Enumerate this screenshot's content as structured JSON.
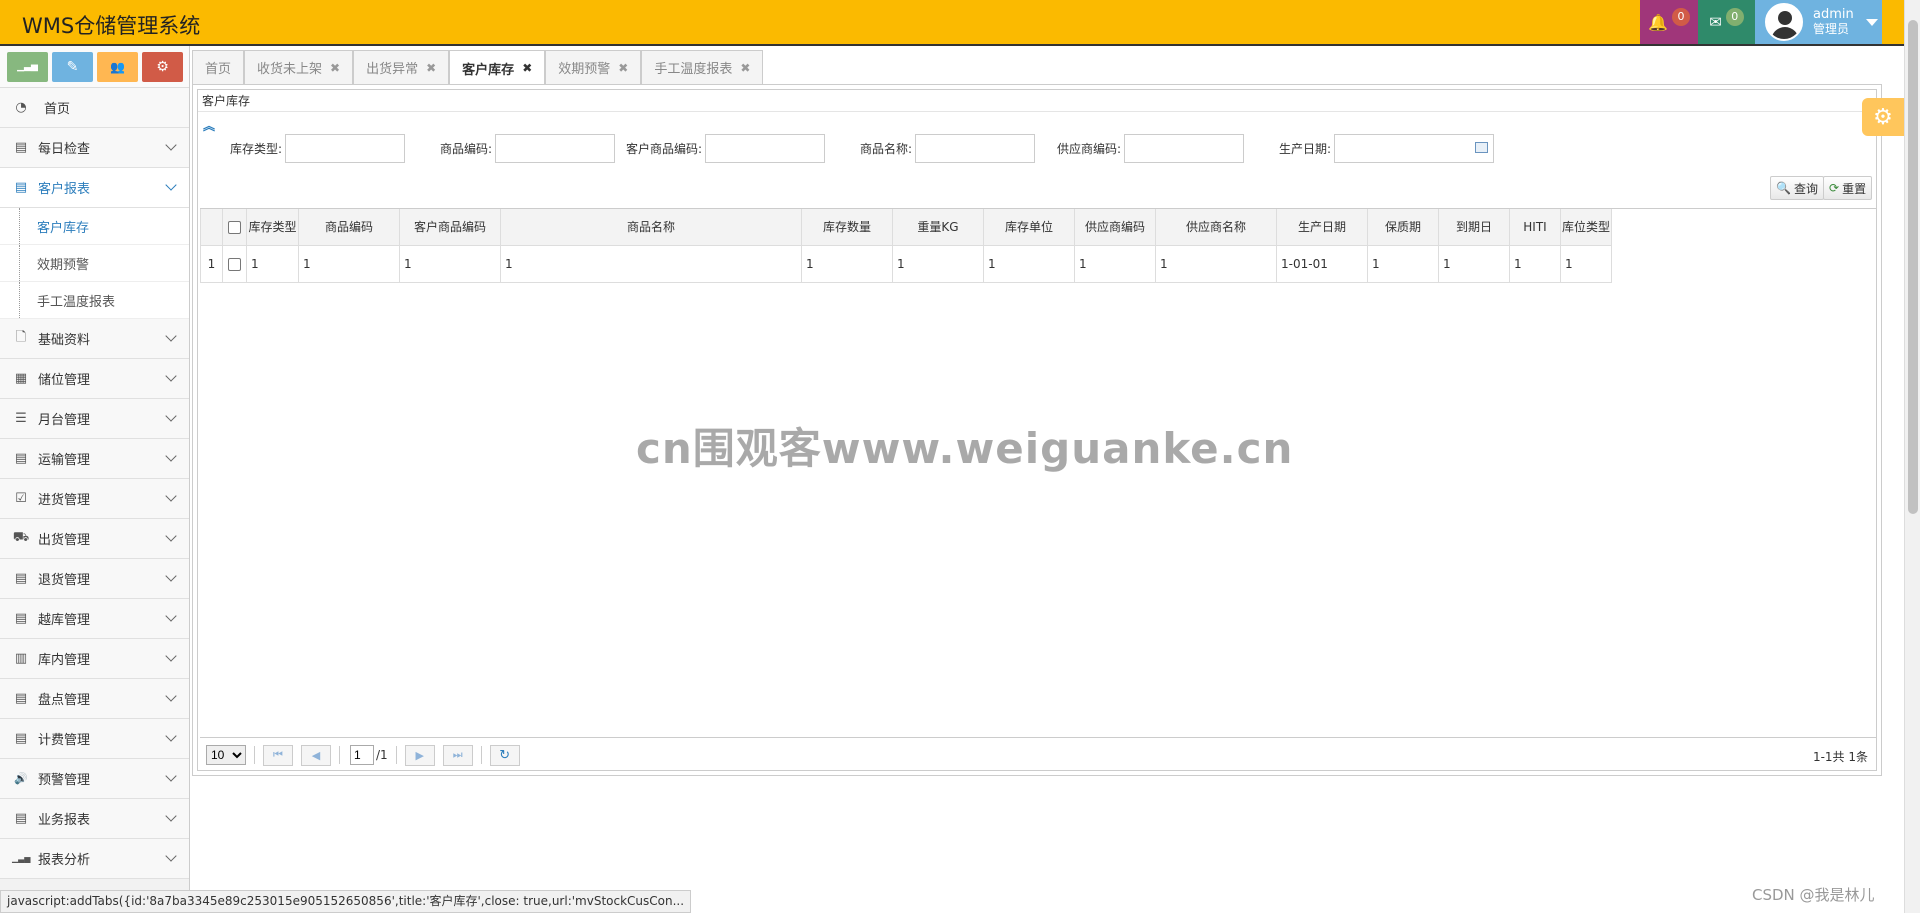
{
  "header": {
    "title": "WMS仓储管理系统",
    "notifications_count": "0",
    "messages_count": "0",
    "username": "admin",
    "role": "管理员",
    "colors": {
      "header_bg": "#fbba00",
      "bell_bg": "#a0367a",
      "mail_bg": "#2f8a6a",
      "user_bg": "#6fb3e0"
    }
  },
  "sidebar": {
    "shortcuts": [
      {
        "icon": "signal-icon",
        "glyph": "▁▃▅"
      },
      {
        "icon": "pencil-icon",
        "glyph": "✎"
      },
      {
        "icon": "group-icon",
        "glyph": "👥"
      },
      {
        "icon": "cogs-icon",
        "glyph": "⚙"
      }
    ],
    "items": [
      {
        "label": "首页",
        "icon": "dashboard-icon",
        "glyph": "◔",
        "expandable": false
      },
      {
        "label": "每日检查",
        "icon": "list-alt-icon",
        "glyph": "▤",
        "expandable": true
      },
      {
        "label": "客户报表",
        "icon": "list-alt-icon",
        "glyph": "▤",
        "expandable": true,
        "active": true
      },
      {
        "label": "基础资料",
        "icon": "file-icon",
        "glyph": "🗋",
        "expandable": true
      },
      {
        "label": "储位管理",
        "icon": "building-icon",
        "glyph": "▦",
        "expandable": true
      },
      {
        "label": "月台管理",
        "icon": "th-list-icon",
        "glyph": "☰",
        "expandable": true
      },
      {
        "label": "运输管理",
        "icon": "list-alt-icon",
        "glyph": "▤",
        "expandable": true
      },
      {
        "label": "进货管理",
        "icon": "check-square-icon",
        "glyph": "☑",
        "expandable": true
      },
      {
        "label": "出货管理",
        "icon": "truck-icon",
        "glyph": "⛟",
        "expandable": true
      },
      {
        "label": "退货管理",
        "icon": "list-alt-icon",
        "glyph": "▤",
        "expandable": true
      },
      {
        "label": "越库管理",
        "icon": "list-alt-icon",
        "glyph": "▤",
        "expandable": true
      },
      {
        "label": "库内管理",
        "icon": "film-icon",
        "glyph": "▥",
        "expandable": true
      },
      {
        "label": "盘点管理",
        "icon": "list-alt-icon",
        "glyph": "▤",
        "expandable": true
      },
      {
        "label": "计费管理",
        "icon": "list-alt-icon",
        "glyph": "▤",
        "expandable": true
      },
      {
        "label": "预警管理",
        "icon": "volume-icon",
        "glyph": "🔊",
        "expandable": true
      },
      {
        "label": "业务报表",
        "icon": "list-alt-icon",
        "glyph": "▤",
        "expandable": true
      },
      {
        "label": "报表分析",
        "icon": "signal-icon",
        "glyph": "▁▃▅",
        "expandable": true
      }
    ],
    "sub_items": [
      {
        "label": "客户库存",
        "active": true
      },
      {
        "label": "效期预警"
      },
      {
        "label": "手工温度报表"
      }
    ]
  },
  "tabs": [
    {
      "label": "首页",
      "closable": false
    },
    {
      "label": "收货未上架",
      "closable": true
    },
    {
      "label": "出货异常",
      "closable": true
    },
    {
      "label": "客户库存",
      "closable": true,
      "active": true
    },
    {
      "label": "效期预警",
      "closable": true
    },
    {
      "label": "手工温度报表",
      "closable": true
    }
  ],
  "panel": {
    "title": "客户库存",
    "collapse_glyph": "︽"
  },
  "search": {
    "fields": [
      {
        "label": "库存类型:",
        "value": ""
      },
      {
        "label": "商品编码:",
        "value": ""
      },
      {
        "label": "客户商品编码:",
        "value": ""
      },
      {
        "label": "商品名称:",
        "value": ""
      },
      {
        "label": "供应商编码:",
        "value": ""
      },
      {
        "label": "生产日期:",
        "value": ""
      }
    ],
    "query_label": "查询",
    "reset_label": "重置"
  },
  "grid": {
    "columns": [
      "库存类型",
      "商品编码",
      "客户商品编码",
      "商品名称",
      "库存数量",
      "重量KG",
      "库存单位",
      "供应商编码",
      "供应商名称",
      "生产日期",
      "保质期",
      "到期日",
      "HITI",
      "库位类型"
    ],
    "rows": [
      {
        "num": "1",
        "cells": [
          "1",
          "1",
          "1",
          "1",
          "1",
          "1",
          "1",
          "1",
          "1",
          "1-01-01",
          "1",
          "1",
          "1",
          "1"
        ]
      }
    ]
  },
  "pager": {
    "page_size": "10",
    "page_size_options": [
      "10"
    ],
    "current_page": "1",
    "total_pages": "/1",
    "info": "1-1共 1条"
  },
  "watermark": "cn围观客www.weiguanke.cn",
  "statusbar": "javascript:addTabs({id:'8a7ba3345e89c253015e905152650856',title:'客户库存',close: true,url:'mvStockCusCon...",
  "footer_credit": "CSDN @我是林儿"
}
